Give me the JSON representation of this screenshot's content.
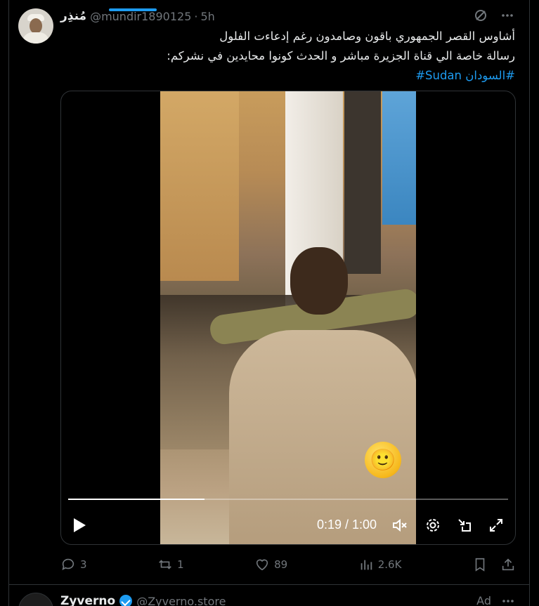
{
  "tweet": {
    "author_name": "مُنذِر",
    "handle": "@mundir1890125",
    "separator": "·",
    "time": "5h",
    "text_lines": [
      "أشاوس القصر الجمهوري باقون وصامدون رغم إدعاءت الفلول",
      "رسالة خاصة الي قناة الجزيرة مباشر و الحدث كونوا محايدين في نشركم:"
    ],
    "hashtags": "#السودان Sudan#",
    "header_icons": [
      "grok-icon",
      "more-icon"
    ]
  },
  "video": {
    "progress_fraction": 0.31,
    "time_readout": "0:19 / 1:00",
    "overlay_emoji": "🙂",
    "controls": [
      "play-icon",
      "mute-icon",
      "settings-icon",
      "minimize-icon",
      "fullscreen-icon"
    ]
  },
  "actions": {
    "replies": "3",
    "reposts": "1",
    "likes": "89",
    "views": "2.6K"
  },
  "next_tweet": {
    "author_name": "Zyverno",
    "handle": "@Zyverno.store",
    "badge": "Ad"
  },
  "colors": {
    "background": "#000000",
    "text": "#e7e9ea",
    "muted": "#71767b",
    "accent": "#1d9bf0",
    "border": "#2f3336"
  }
}
